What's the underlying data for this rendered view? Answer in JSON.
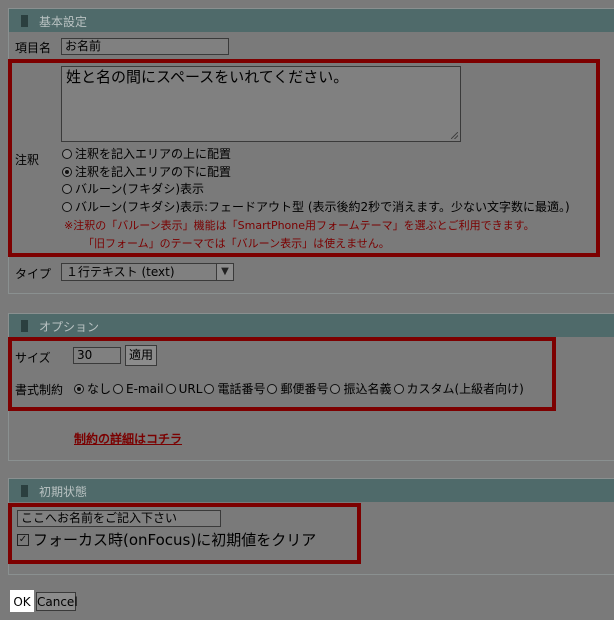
{
  "basic": {
    "title": "基本設定",
    "item_name_label": "項目名",
    "item_name_value": "お名前",
    "note_label": "注釈",
    "note_value": "姓と名の間にスペースをいれてください。",
    "placement_options": [
      {
        "label": "注釈を記入エリアの上に配置",
        "selected": false
      },
      {
        "label": "注釈を記入エリアの下に配置",
        "selected": true
      },
      {
        "label": "バルーン(フキダシ)表示",
        "selected": false
      },
      {
        "label": "バルーン(フキダシ)表示:フェードアウト型 (表示後約2秒で消えます。少ない文字数に最適。)",
        "selected": false
      }
    ],
    "warning_line1": "※注釈の「バルーン表示」機能は「SmartPhone用フォームテーマ」を選ぶとご利用できます。",
    "warning_line2": "「旧フォーム」のテーマでは「バルーン表示」は使えません。",
    "type_label": "タイプ",
    "type_value": "１行テキスト (text)"
  },
  "options": {
    "title": "オプション",
    "size_label": "サイズ",
    "size_value": "30",
    "apply_label": "適用",
    "restrict_label": "書式制約",
    "restrict_options": [
      {
        "label": "なし",
        "selected": true
      },
      {
        "label": "E-mail",
        "selected": false
      },
      {
        "label": "URL",
        "selected": false
      },
      {
        "label": "電話番号",
        "selected": false
      },
      {
        "label": "郵便番号",
        "selected": false
      },
      {
        "label": "振込名義",
        "selected": false
      },
      {
        "label": "カスタム(上級者向け)",
        "selected": false
      }
    ],
    "detail_link": "制約の詳細はコチラ"
  },
  "initial": {
    "title": "初期状態",
    "default_value": "ここへお名前をご記入下さい",
    "clear_on_focus_label": "フォーカス時(onFocus)に初期値をクリア",
    "clear_on_focus_checked": true,
    "check_glyph": "✓"
  },
  "footer": {
    "ok_label": "OK",
    "cancel_label": "Cancel"
  }
}
